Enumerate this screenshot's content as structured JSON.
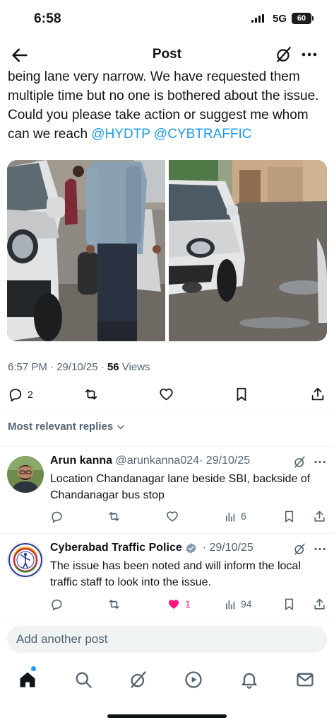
{
  "status_bar": {
    "time": "6:58",
    "network": "5G",
    "battery": "60"
  },
  "header": {
    "title": "Post"
  },
  "tweet": {
    "text": "being lane very narrow. We have requested them multiple time but no one is bothered about the issue. Could you please take action or suggest me whom can we reach ",
    "mention_1": "@HYDTP",
    "mention_2": "@CYBTRAFFIC",
    "time": "6:57 PM",
    "date": "29/10/25",
    "views_count": "56",
    "views_label": "Views",
    "replies_count": "2"
  },
  "replies_sort": {
    "label": "Most relevant replies"
  },
  "replies": [
    {
      "name": "Arun kanna",
      "handle": "@arunkanna024",
      "date": "· 29/10/25",
      "text": "Location Chandanagar lane beside SBI, backside of Chandanagar bus stop",
      "views": "6",
      "likes": ""
    },
    {
      "name": "Cyberabad Traffic Police",
      "handle": "",
      "date": "· 29/10/25",
      "text": "The issue has been noted and will inform the local traffic staff to look into the issue.",
      "views": "94",
      "likes": "1"
    }
  ],
  "composer": {
    "placeholder": "Add another post"
  },
  "colors": {
    "accent": "#1d9bf0",
    "like": "#f91880",
    "verified": "#829aab",
    "muted": "#536471"
  }
}
